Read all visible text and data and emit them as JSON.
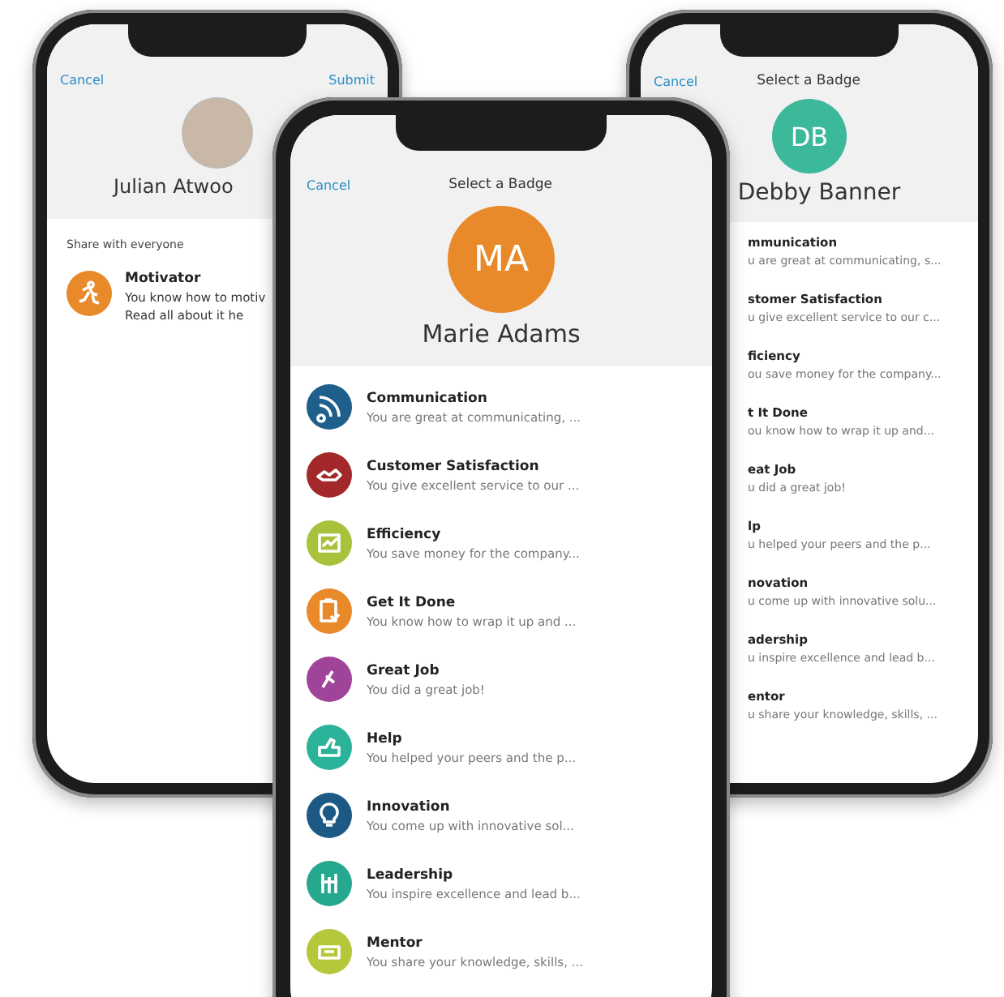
{
  "left_phone": {
    "cancel": "Cancel",
    "submit": "Submit",
    "name": "Julian Atwoo",
    "section_label": "Share with everyone",
    "badge": {
      "title": "Motivator",
      "lines": [
        "You know how to motiv",
        "Read all about it he"
      ]
    }
  },
  "center_phone": {
    "cancel": "Cancel",
    "title": "Select a Badge",
    "initials": "MA",
    "name": "Marie Adams",
    "badges": [
      {
        "title": "Communication",
        "description": "You are great at communicating, ...",
        "color": "#1f5f8b"
      },
      {
        "title": "Customer Satisfaction",
        "description": "You give excellent service to our ...",
        "color": "#a3282a"
      },
      {
        "title": "Efficiency",
        "description": "You save money for the company...",
        "color": "#a9c23c"
      },
      {
        "title": "Get It Done",
        "description": "You know how to wrap it up and ...",
        "color": "#e8892a"
      },
      {
        "title": "Great Job",
        "description": "You did a great job!",
        "color": "#a0449a"
      },
      {
        "title": "Help",
        "description": "You helped your peers and the p...",
        "color": "#2bb39a"
      },
      {
        "title": "Innovation",
        "description": "You come up with innovative sol...",
        "color": "#1c5a85"
      },
      {
        "title": "Leadership",
        "description": "You inspire excellence and lead b...",
        "color": "#25a88e"
      },
      {
        "title": "Mentor",
        "description": "You share your knowledge, skills, ...",
        "color": "#b5c73a"
      }
    ]
  },
  "right_phone": {
    "cancel": "Cancel",
    "title": "Select a Badge",
    "initials": "DB",
    "name": "Debby Banner",
    "badges": [
      {
        "title": "mmunication",
        "description": "u are great at communicating, s..."
      },
      {
        "title": "stomer Satisfaction",
        "description": "u give excellent service to our c..."
      },
      {
        "title": "ficiency",
        "description": "ou save money for the company..."
      },
      {
        "title": "t It Done",
        "description": "ou know how to wrap it up and..."
      },
      {
        "title": "eat Job",
        "description": "u did a great job!"
      },
      {
        "title": "lp",
        "description": "u helped your peers and the p..."
      },
      {
        "title": "novation",
        "description": "u come up with innovative solu..."
      },
      {
        "title": "adership",
        "description": "u inspire excellence and lead b..."
      },
      {
        "title": "entor",
        "description": "u share your knowledge, skills, ..."
      }
    ]
  }
}
